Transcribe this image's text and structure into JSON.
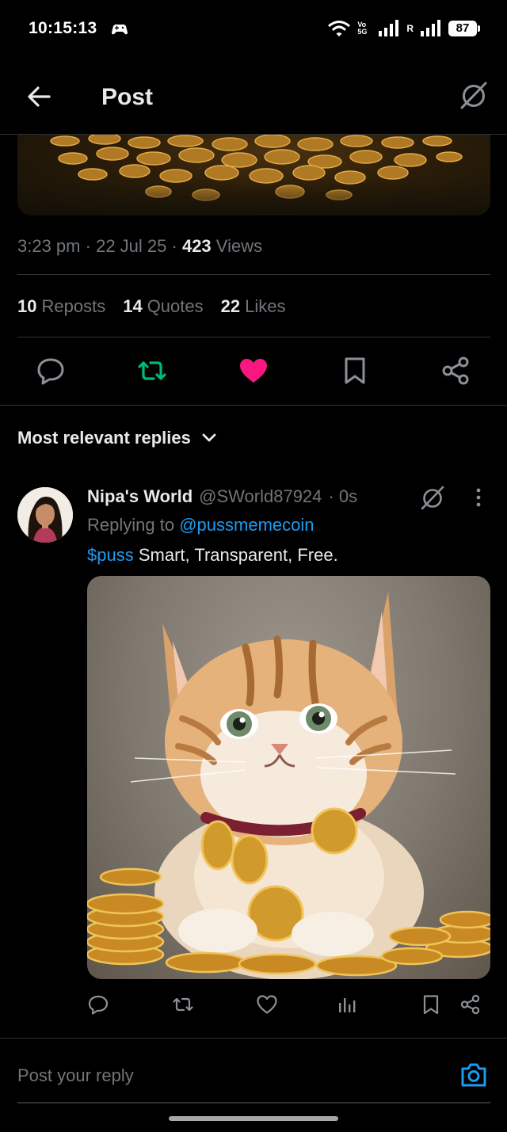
{
  "status_bar": {
    "time": "10:15:13",
    "volte_label": "Vo 5G",
    "roaming_label": "R",
    "battery": "87"
  },
  "nav": {
    "title": "Post",
    "back_icon": "arrow-left-icon",
    "grok_icon": "grok-icon"
  },
  "post": {
    "time": "3:23 pm",
    "date": "22 Jul 25",
    "views_count": "423",
    "views_label": "Views",
    "separator": "·",
    "stats": {
      "reposts_count": "10",
      "reposts_label": "Reposts",
      "quotes_count": "14",
      "quotes_label": "Quotes",
      "likes_count": "22",
      "likes_label": "Likes"
    },
    "liked": true,
    "reposted": true,
    "colors": {
      "repost": "#00ba7c",
      "like": "#f91880"
    }
  },
  "replies": {
    "sort_label": "Most relevant replies",
    "items": [
      {
        "name": "Nipa's World",
        "handle": "@SWorld87924",
        "time": "· 0s",
        "replying_prefix": "Replying to",
        "replying_handle": "@pussmemecoin",
        "cashtag": "$puss",
        "text": " Smart, Transparent, Free.",
        "media_alt": "kitten with gold coins"
      }
    ]
  },
  "compose": {
    "placeholder": "Post your reply"
  },
  "theme": {
    "accent": "#1d9bf0",
    "background": "#000000",
    "muted_text": "#71767b",
    "divider": "#2f3336"
  }
}
